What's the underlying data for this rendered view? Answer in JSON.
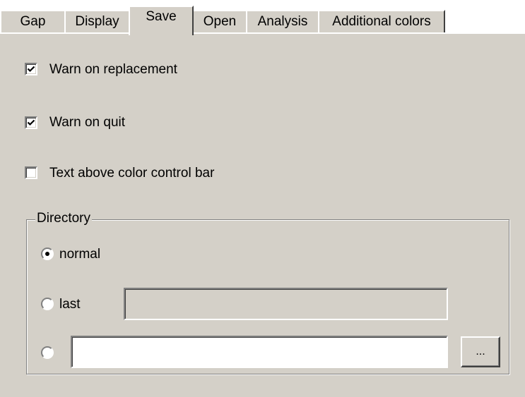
{
  "tabs": [
    {
      "label": "Gap",
      "active": false
    },
    {
      "label": "Display",
      "active": false
    },
    {
      "label": "Save",
      "active": true
    },
    {
      "label": "Open",
      "active": false
    },
    {
      "label": "Analysis",
      "active": false
    },
    {
      "label": "Additional colors",
      "active": false
    }
  ],
  "options": {
    "warn_on_replacement": {
      "label": "Warn on replacement",
      "checked": true
    },
    "warn_on_quit": {
      "label": "Warn on quit",
      "checked": true
    },
    "text_above_color_bar": {
      "label": "Text above color control bar",
      "checked": false
    }
  },
  "directory": {
    "title": "Directory",
    "normal": {
      "label": "normal",
      "selected": true
    },
    "last": {
      "label": "last",
      "selected": false,
      "value": ""
    },
    "custom": {
      "selected": false,
      "value": ""
    },
    "browse_label": "..."
  },
  "colors": {
    "face": "#d4d0c8",
    "highlight": "#ffffff",
    "shadow": "#808080",
    "dark_shadow": "#404040",
    "disabled_field": "#d4d0c8"
  }
}
